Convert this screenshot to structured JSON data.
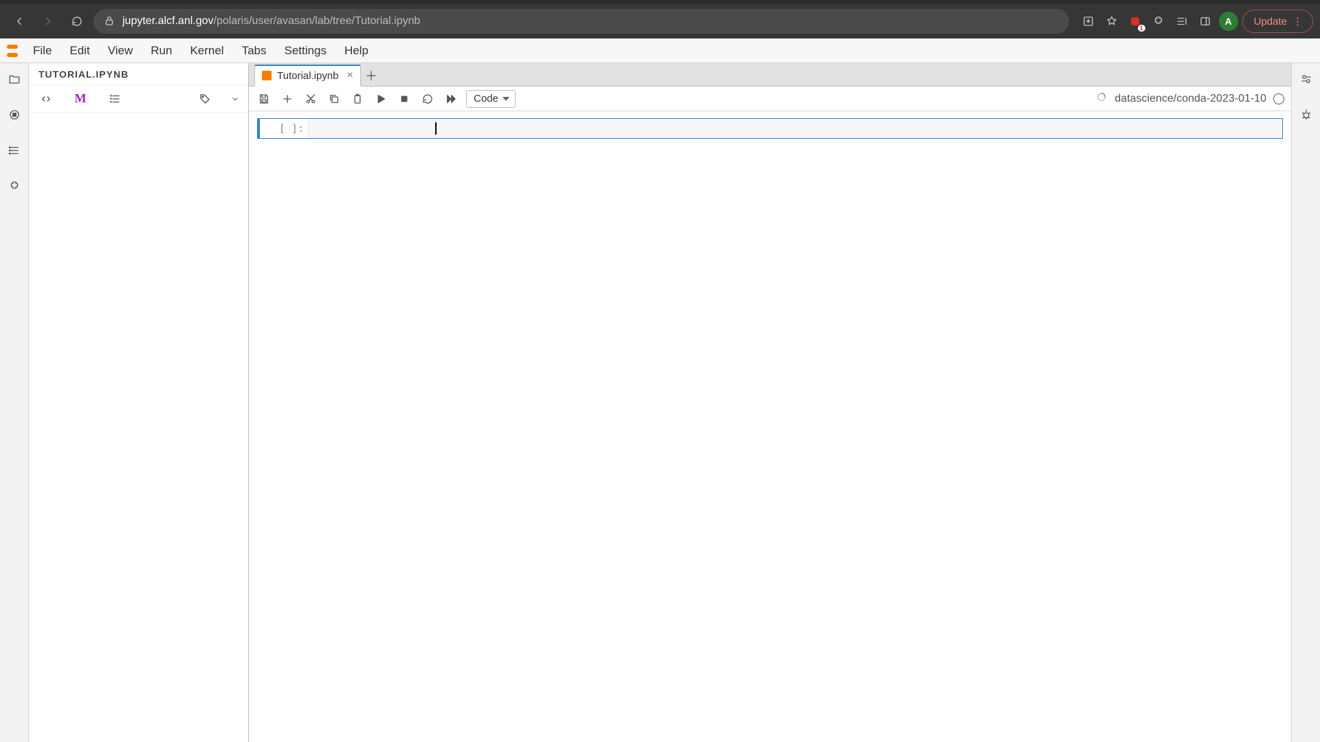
{
  "browser": {
    "url_host": "jupyter.alcf.anl.gov",
    "url_path": "/polaris/user/avasan/lab/tree/Tutorial.ipynb",
    "avatar_letter": "A",
    "update_label": "Update"
  },
  "menu": {
    "file": "File",
    "edit": "Edit",
    "view": "View",
    "run": "Run",
    "kernel": "Kernel",
    "tabs": "Tabs",
    "settings": "Settings",
    "help": "Help"
  },
  "left_panel": {
    "header": "TUTORIAL.IPYNB"
  },
  "tab": {
    "title": "Tutorial.ipynb"
  },
  "toolbar": {
    "cell_type": "Code",
    "kernel_name": "datascience/conda-2023-01-10"
  },
  "cell": {
    "prompt": "[  ]:"
  }
}
